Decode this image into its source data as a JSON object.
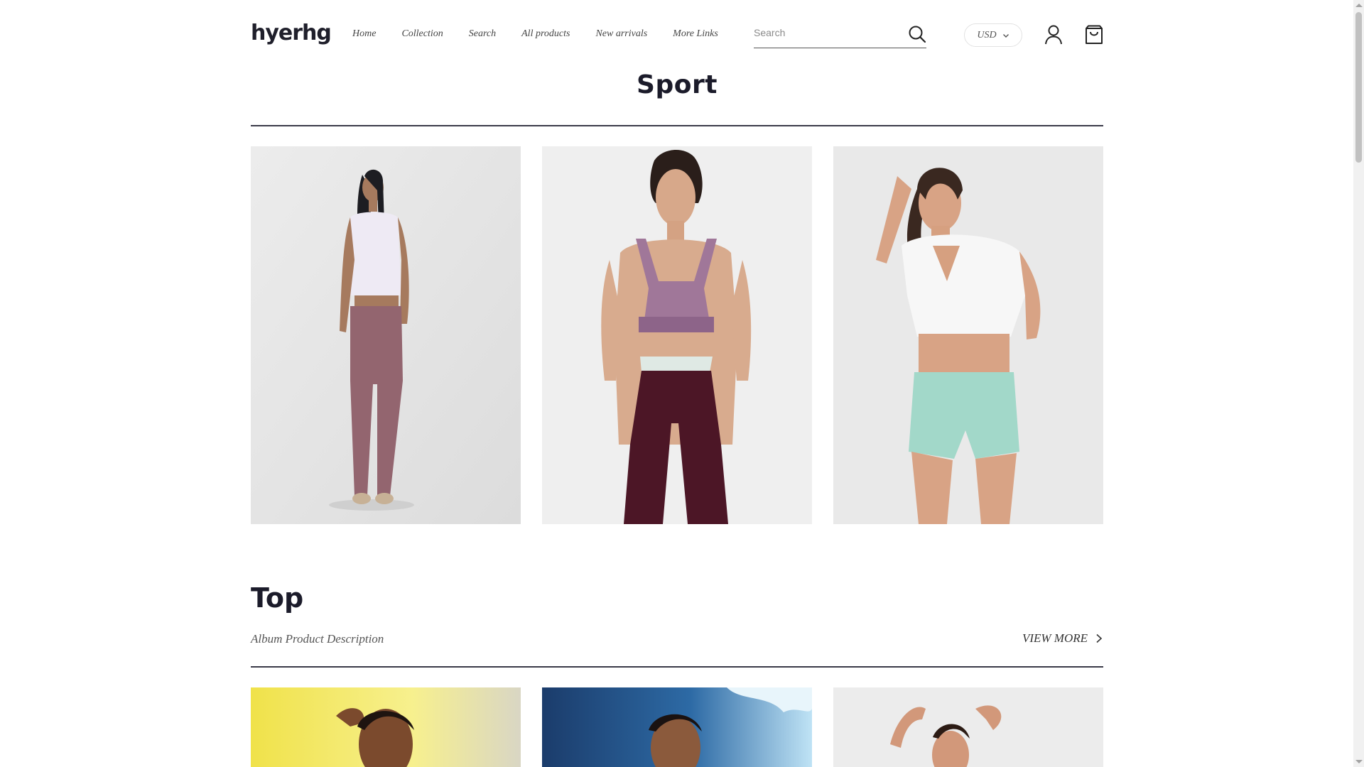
{
  "header": {
    "logo": "hyerhg",
    "nav": [
      "Home",
      "Collection",
      "Search",
      "All products",
      "New arrivals",
      "More Links"
    ],
    "search_placeholder": "Search",
    "currency": "USD"
  },
  "sport": {
    "title": "Sport",
    "products": [
      {
        "alt": "Model in white crop top and mauve pants"
      },
      {
        "alt": "Model in mauve sports bra and maroon leggings"
      },
      {
        "alt": "Model in white sleeveless hoodie and mint shorts"
      }
    ]
  },
  "top": {
    "title": "Top",
    "description": "Album Product Description",
    "view_more": "VIEW MORE"
  },
  "colors": {
    "text": "#1b1b2a",
    "divider": "#3a3a48",
    "scrollbar": "#c1c1c1"
  }
}
